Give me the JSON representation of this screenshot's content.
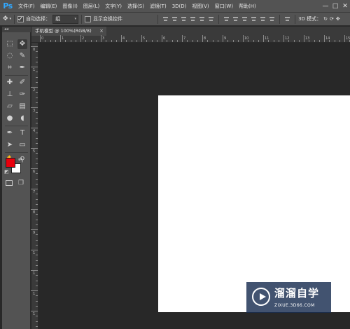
{
  "app": {
    "logo": "Ps"
  },
  "menu": {
    "items": [
      "文件(F)",
      "编辑(E)",
      "图像(I)",
      "图层(L)",
      "文字(Y)",
      "选择(S)",
      "滤镜(T)",
      "3D(D)",
      "视图(V)",
      "窗口(W)",
      "帮助(H)"
    ],
    "window_controls": [
      "—",
      "□",
      "✕"
    ]
  },
  "options": {
    "auto_select_label": "自动选择：",
    "auto_select_checked": true,
    "auto_select_value": "组",
    "show_transform_label": "显示变换控件",
    "show_transform_checked": false,
    "mode_3d_label": "3D 模式："
  },
  "tools_panel": {
    "collapse_glyph": "◂◂",
    "foreground_color": "#e8000d",
    "background_color": "#ffffff"
  },
  "document": {
    "tab_title": "手机模型 @ 100%(RGB/8)",
    "close_glyph": "×"
  },
  "rulers": {
    "top_labels": [
      "0",
      "1",
      "2",
      "3",
      "4",
      "5",
      "6",
      "7",
      "8",
      "9",
      "10",
      "11",
      "12",
      "13",
      "14",
      "15"
    ],
    "left_labels": [
      "0",
      "1",
      "2",
      "3",
      "4",
      "5",
      "6",
      "7",
      "8",
      "9",
      "1",
      "1",
      "1",
      "1"
    ]
  },
  "watermark": {
    "title": "溜溜自学",
    "url": "ZIXUE.3D66.COM"
  }
}
